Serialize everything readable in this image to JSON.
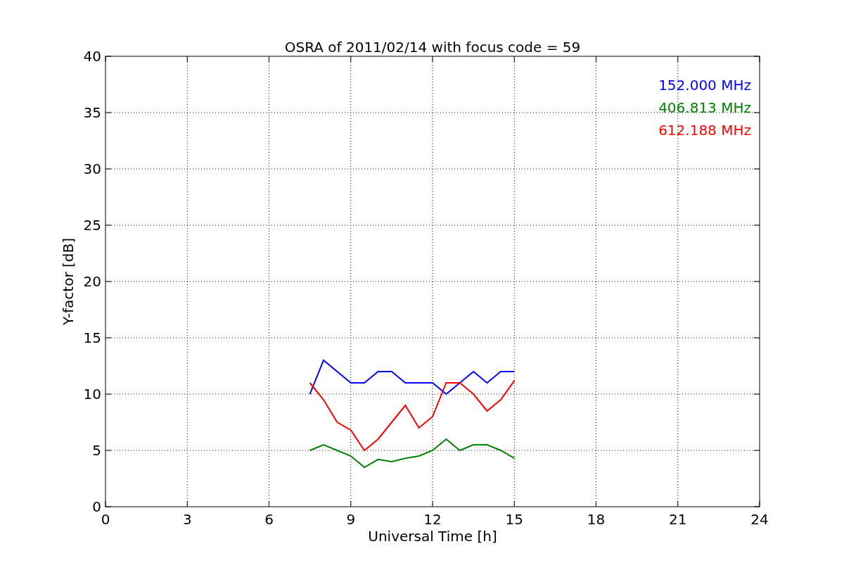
{
  "chart_data": {
    "type": "line",
    "title": "OSRA of 2011/02/14 with focus code = 59",
    "xlabel": "Universal Time [h]",
    "ylabel": "Y-factor [dB]",
    "x": [
      7.5,
      8,
      8.5,
      9,
      9.5,
      10,
      10.5,
      11,
      11.5,
      12,
      12.5,
      13,
      13.5,
      14,
      14.5,
      15
    ],
    "series": [
      {
        "name": "152.000 MHz",
        "color": "#0000ff",
        "values": [
          10,
          13,
          12,
          11,
          11,
          12,
          12,
          11,
          11,
          11,
          10,
          11,
          12,
          11,
          12,
          12
        ]
      },
      {
        "name": "406.813 MHz",
        "color": "#008000",
        "values": [
          5,
          5.5,
          5,
          4.5,
          3.5,
          4.2,
          4,
          4.3,
          4.5,
          5,
          6,
          5,
          5.5,
          5.5,
          5,
          4.3
        ]
      },
      {
        "name": "612.188 MHz",
        "color": "#ff0000",
        "values": [
          11,
          9.5,
          7.5,
          6.8,
          5,
          6,
          7.5,
          9,
          7,
          8,
          11,
          11,
          10,
          8.5,
          9.5,
          11.2
        ]
      }
    ],
    "grid": true,
    "xlim": [
      0,
      24
    ],
    "ylim": [
      0,
      40
    ],
    "xticks": [
      0,
      3,
      6,
      9,
      12,
      15,
      18,
      21,
      24
    ],
    "yticks": [
      0,
      5,
      10,
      15,
      20,
      25,
      30,
      35,
      40
    ]
  }
}
